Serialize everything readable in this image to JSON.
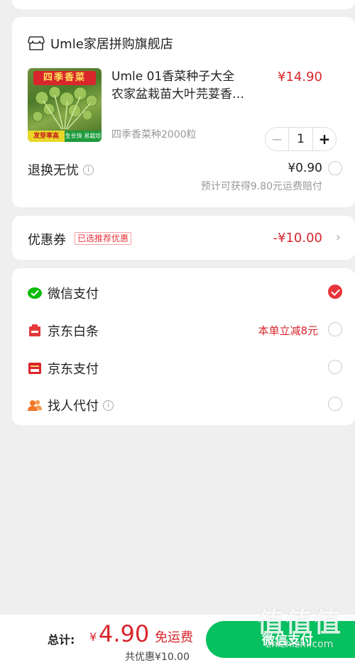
{
  "shop": {
    "name": "Umle家居拼购旗舰店",
    "product": {
      "thumb_title": "四季香菜",
      "thumb_badge_left": "发芽率高",
      "thumb_badge_right": "生长快 易栽培",
      "title_line1": "Umle 01香菜种子大全",
      "title_line2": "农家盆栽苗大叶芫荽香菜种籽",
      "price": "¥14.90",
      "spec": "四季香菜种2000粒",
      "quantity": "1",
      "minus": "−",
      "plus": "+"
    },
    "return_service": {
      "label": "退换无忧",
      "info": "i",
      "price": "¥0.90",
      "note": "预计可获得9.80元运费赔付"
    }
  },
  "coupon": {
    "label": "优惠券",
    "tag": "已选推荐优惠",
    "amount": "-¥10.00",
    "chevron": "›"
  },
  "payment": {
    "methods": [
      {
        "label": "微信支付",
        "icon": "wechat-pay-icon",
        "selected": true,
        "promo": ""
      },
      {
        "label": "京东白条",
        "icon": "jd-baitiao-icon",
        "selected": false,
        "promo": "本单立减8元"
      },
      {
        "label": "京东支付",
        "icon": "jd-pay-icon",
        "selected": false,
        "promo": ""
      },
      {
        "label": "找人代付",
        "icon": "friend-pay-icon",
        "selected": false,
        "promo": ""
      }
    ],
    "info": "i"
  },
  "bottom": {
    "total_label": "总计:",
    "currency": "¥",
    "total_amount": "4.90",
    "free_shipping": "免运费",
    "saved": "共优惠¥10.00",
    "pay_button": "微信支付"
  },
  "watermark": {
    "big": "值值值",
    "small": "zhizhizhi.com"
  },
  "colors": {
    "accent_red": "#d8262c",
    "wechat_green": "#07c160",
    "background": "#efefef"
  }
}
